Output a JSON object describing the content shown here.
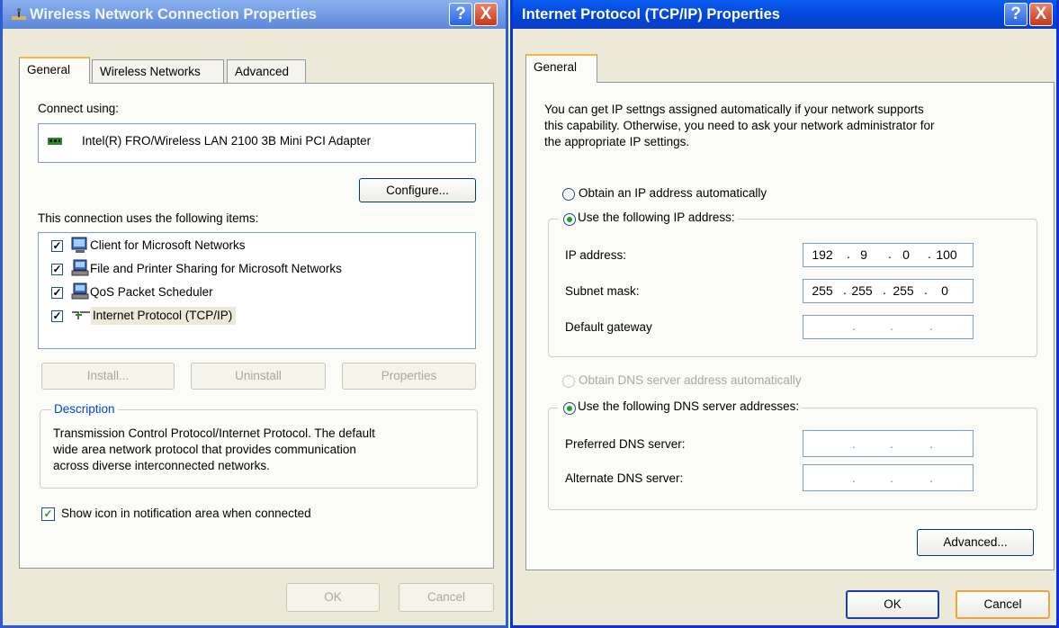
{
  "left_window": {
    "title": "Wireless Network Connection Properties",
    "tabs": [
      "General",
      "Wireless Networks",
      "Advanced"
    ],
    "connect_using_label": "Connect using:",
    "adapter_name": "Intel(R) FRO/Wireless LAN 2100 3B Mini PCI Adapter",
    "configure_label": "Configure...",
    "items_label": "This connection uses the following items:",
    "items": [
      {
        "label": "Client for Microsoft Networks",
        "checked": true,
        "icon": "network-client-icon"
      },
      {
        "label": "File and Printer Sharing for Microsoft Networks",
        "checked": true,
        "icon": "network-service-icon"
      },
      {
        "label": "QoS Packet Scheduler",
        "checked": true,
        "icon": "network-service-icon"
      },
      {
        "label": "Internet Protocol (TCP/IP)",
        "checked": true,
        "icon": "protocol-icon"
      }
    ],
    "install_label": "Install...",
    "uninstall_label": "Uninstall",
    "properties_label": "Properties",
    "description_legend": "Description",
    "description_text_1": "Transmission Control Protocol/Internet Protocol. The default",
    "description_text_2": "wide area network protocol that provides communication",
    "description_text_3": "across diverse interconnected networks.",
    "show_icon_label": "Show icon in notification area when connected",
    "show_icon_checked": true,
    "ok_label": "OK",
    "cancel_label": "Cancel"
  },
  "right_window": {
    "title": "Internet Protocol (TCP/IP) Properties",
    "tab": "General",
    "intro_1": "You can get IP settngs assigned automatically if your network supports",
    "intro_2": "this capability. Otherwise, you need to ask your network administrator for",
    "intro_3": "the appropriate IP settings.",
    "obtain_ip_label": "Obtain an IP address automatically",
    "use_ip_label": "Use the following IP address:",
    "ip_address_label": "IP address:",
    "ip_address": [
      "192",
      "9",
      "0",
      "100"
    ],
    "subnet_label": "Subnet mask:",
    "subnet_mask": [
      "255",
      "255",
      "255",
      "0"
    ],
    "gateway_label": "Default gateway",
    "obtain_dns_label": "Obtain DNS server address automatically",
    "use_dns_label": "Use the following DNS server addresses:",
    "preferred_dns_label": "Preferred DNS server:",
    "alternate_dns_label": "Alternate DNS server:",
    "advanced_label": "Advanced...",
    "ok_label": "OK",
    "cancel_label": "Cancel",
    "selected_ip_mode": "use_following",
    "selected_dns_mode": "use_following"
  },
  "colors": {
    "titlebar_left": "#0a246a",
    "titlebar_right": "#0054e3",
    "dialog_bg": "#ece9d8",
    "selection_bg": "#ece9d8",
    "radio_dot": "#21a121",
    "tab_highlight": "#f9b63c"
  },
  "icons": {
    "help": "?",
    "close": "X",
    "check": "✓"
  }
}
